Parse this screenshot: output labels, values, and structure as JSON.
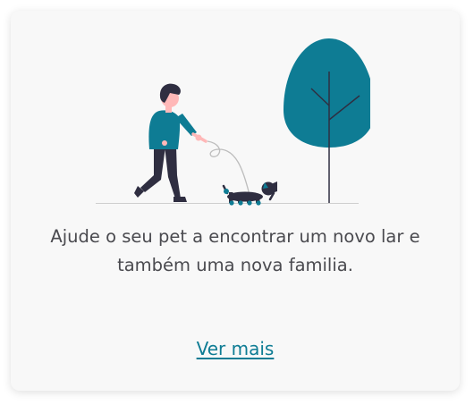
{
  "card": {
    "description_line1": "Ajude o seu pet a encontrar um novo lar e",
    "description_line2": "também uma nova familia.",
    "cta_label": "Ver mais"
  },
  "illustration": {
    "icon": "person-walking-dog-illustration",
    "colors": {
      "accent": "#0e7c94",
      "dark": "#2f2e41",
      "skin": "#ffb8b8",
      "ground": "#cfcfcf"
    }
  }
}
